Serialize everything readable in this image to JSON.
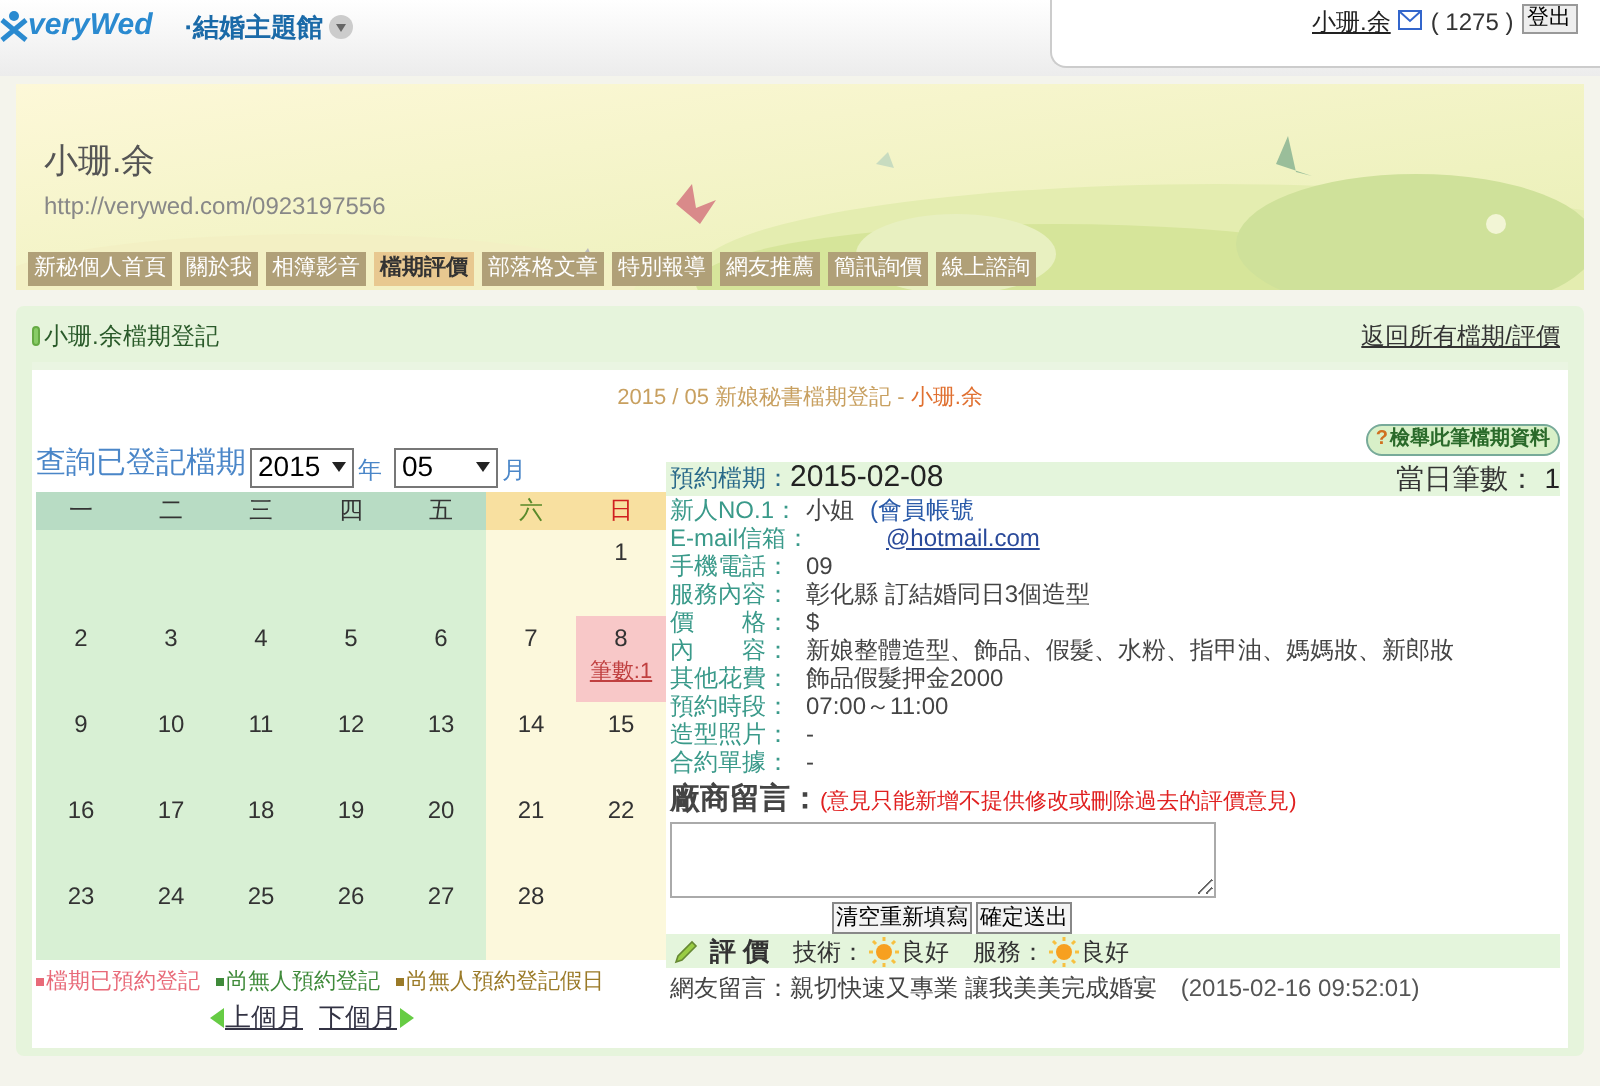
{
  "topbar": {
    "logo": "veryWed",
    "menu": "·結婚主題館",
    "user": "小珊.余",
    "message_count": "( 1275 )",
    "logout": "登出"
  },
  "banner": {
    "name": "小珊.余",
    "url": "http://verywed.com/0923197556"
  },
  "nav": [
    {
      "label": "新秘個人首頁",
      "selected": false
    },
    {
      "label": "關於我",
      "selected": false
    },
    {
      "label": "相簿影音",
      "selected": false
    },
    {
      "label": "檔期評價",
      "selected": true
    },
    {
      "label": "部落格文章",
      "selected": false
    },
    {
      "label": "特別報導",
      "selected": false
    },
    {
      "label": "網友推薦",
      "selected": false
    },
    {
      "label": "簡訊詢價",
      "selected": false
    },
    {
      "label": "線上諮詢",
      "selected": false
    }
  ],
  "section": {
    "title": "小珊.余檔期登記",
    "back_link": "返回所有檔期/評價"
  },
  "heading": {
    "text": "2015 / 05 新娘秘書檔期登記 - ",
    "name": "小珊.余"
  },
  "query": {
    "label": "查詢已登記檔期",
    "year": "2015",
    "year_unit": "年",
    "month": "05",
    "month_unit": "月"
  },
  "calendar": {
    "weekdays": [
      {
        "label": "一",
        "holiday": false
      },
      {
        "label": "二",
        "holiday": false
      },
      {
        "label": "三",
        "holiday": false
      },
      {
        "label": "四",
        "holiday": false
      },
      {
        "label": "五",
        "holiday": false
      },
      {
        "label": "六",
        "holiday": true
      },
      {
        "label": "日",
        "holiday": true
      }
    ],
    "weeks": [
      [
        {
          "kind": "blank"
        },
        {
          "kind": "blank"
        },
        {
          "kind": "blank"
        },
        {
          "kind": "blank"
        },
        {
          "kind": "blank"
        },
        {
          "kind": "blank"
        },
        {
          "kind": "day",
          "day": "1",
          "booked": false
        }
      ],
      [
        {
          "day": "2",
          "booked": false
        },
        {
          "day": "3",
          "booked": false
        },
        {
          "day": "4",
          "booked": false
        },
        {
          "day": "5",
          "booked": false
        },
        {
          "day": "6",
          "booked": false
        },
        {
          "day": "7",
          "booked": false
        },
        {
          "day": "8",
          "booked": true,
          "count": "筆數:1"
        }
      ],
      [
        {
          "day": "9",
          "booked": false
        },
        {
          "day": "10",
          "booked": false
        },
        {
          "day": "11",
          "booked": false
        },
        {
          "day": "12",
          "booked": false
        },
        {
          "day": "13",
          "booked": false
        },
        {
          "day": "14",
          "booked": false
        },
        {
          "day": "15",
          "booked": false
        }
      ],
      [
        {
          "day": "16",
          "booked": false
        },
        {
          "day": "17",
          "booked": false
        },
        {
          "day": "18",
          "booked": false
        },
        {
          "day": "19",
          "booked": false
        },
        {
          "day": "20",
          "booked": false
        },
        {
          "day": "21",
          "booked": false
        },
        {
          "day": "22",
          "booked": false
        }
      ],
      [
        {
          "day": "23",
          "booked": false
        },
        {
          "day": "24",
          "booked": false
        },
        {
          "day": "25",
          "booked": false
        },
        {
          "day": "26",
          "booked": false
        },
        {
          "day": "27",
          "booked": false
        },
        {
          "day": "28",
          "booked": false
        },
        {
          "kind": "blank"
        }
      ]
    ],
    "legend": [
      {
        "label": "檔期已預約登記",
        "color": "#e86a78"
      },
      {
        "label": "尚無人預約登記",
        "color": "#3f8a3a"
      },
      {
        "label": "尚無人預約登記假日",
        "color": "#9a7a28"
      }
    ],
    "prev": "上個月",
    "next": "下個月"
  },
  "detail": {
    "report_icon": "?",
    "report_button": "檢舉此筆檔期資料",
    "date_label": "預約檔期：",
    "date": "2015-02-08",
    "count_label": "當日筆數：",
    "count": "1",
    "fields": [
      {
        "label": "新人NO.1：",
        "value": "小姐",
        "extra": "(會員帳號"
      },
      {
        "label": "E-mail信箱：",
        "value": "@hotmail.com",
        "kind": "link"
      },
      {
        "label": "手機電話：",
        "value": "09"
      },
      {
        "label": "服務內容：",
        "value": "彰化縣 訂結婚同日3個造型"
      },
      {
        "label": "價　　格：",
        "value": "$"
      },
      {
        "label": "內　　容：",
        "value": "新娘整體造型、飾品、假髮、水粉、指甲油、媽媽妝、新郎妝"
      },
      {
        "label": "其他花費：",
        "value": "飾品假髮押金2000"
      },
      {
        "label": "預約時段：",
        "value": "07:00～11:00"
      },
      {
        "label": "造型照片：",
        "value": "-"
      },
      {
        "label": "合約單據：",
        "value": "-"
      }
    ],
    "reply_label": "廠商留言：",
    "reply_note": "(意見只能新增不提供修改或刪除過去的評價意見)",
    "clear_button": "清空重新填寫",
    "submit_button": "確定送出",
    "rating_title": "評 價",
    "ratings": [
      {
        "label": "技術：",
        "value": "良好"
      },
      {
        "label": "服務：",
        "value": "良好"
      }
    ],
    "comment": "網友留言：親切快速又專業 讓我美美完成婚宴",
    "comment_time": "(2015-02-16 09:52:01)"
  }
}
